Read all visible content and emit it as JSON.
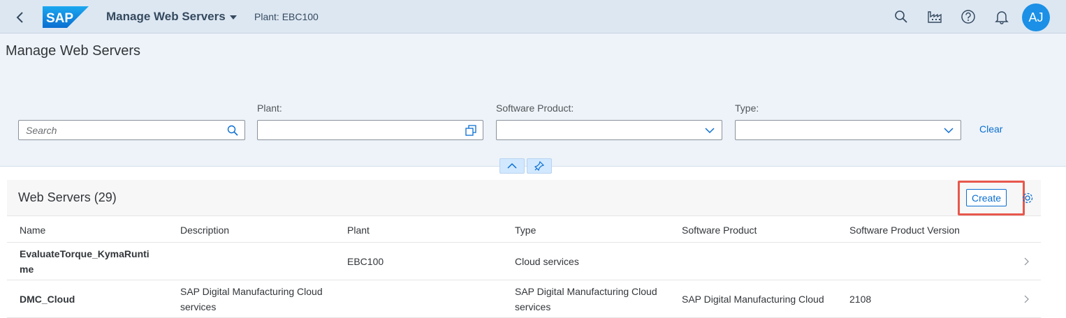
{
  "shell": {
    "logo_text": "SAP",
    "app_title": "Manage Web Servers",
    "context": "Plant: EBC100",
    "avatar": "AJ"
  },
  "page": {
    "title": "Manage Web Servers"
  },
  "filters": {
    "search_placeholder": "Search",
    "plant_label": "Plant:",
    "software_product_label": "Software Product:",
    "type_label": "Type:",
    "clear_label": "Clear"
  },
  "table": {
    "title": "Web Servers (29)",
    "create_label": "Create",
    "columns": [
      "Name",
      "Description",
      "Plant",
      "Type",
      "Software Product",
      "Software Product Version"
    ],
    "rows": [
      {
        "name_line1": "EvaluateTorque_KymaRunti",
        "name_line2": "me",
        "description_line1": "",
        "description_line2": "",
        "plant": "EBC100",
        "type_line1": "Cloud services",
        "type_line2": "",
        "software_product": "",
        "version": ""
      },
      {
        "name_line1": "DMC_Cloud",
        "name_line2": "",
        "description_line1": "SAP Digital Manufacturing Cloud",
        "description_line2": "services",
        "plant": "",
        "type_line1": "SAP Digital Manufacturing Cloud",
        "type_line2": "services",
        "software_product": "SAP Digital Manufacturing Cloud",
        "version": "2108"
      }
    ]
  },
  "colors": {
    "accent": "#0a6ed1",
    "highlight": "#e8574c",
    "shell": "#dde7f2",
    "avatar": "#1b90e6"
  }
}
